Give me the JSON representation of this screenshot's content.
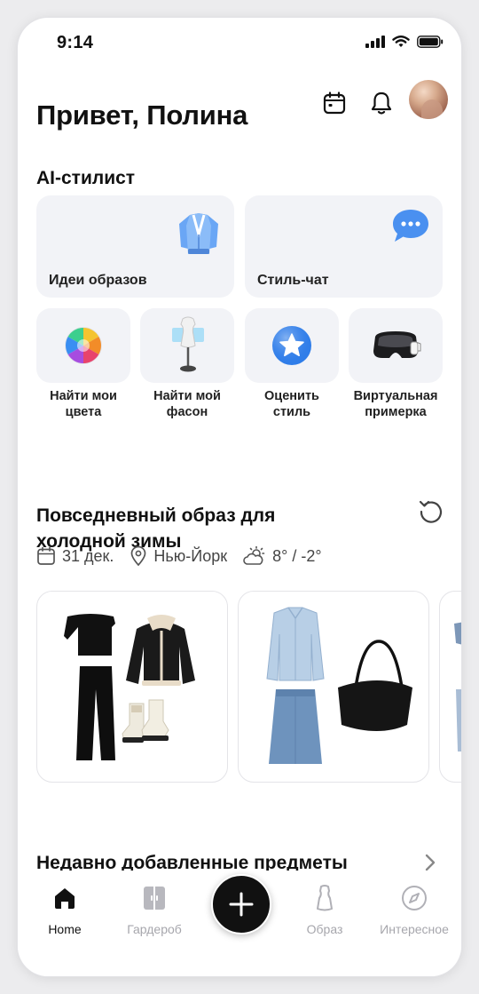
{
  "status_bar": {
    "time": "9:14"
  },
  "header": {
    "greeting": "Привет, Полина"
  },
  "ai_stylist": {
    "title": "AI-стилист",
    "big_cards": [
      {
        "label": "Идеи образов",
        "icon": "cardigan-icon"
      },
      {
        "label": "Стиль-чат",
        "icon": "chat-bubble-icon"
      }
    ],
    "small_cards": [
      {
        "line1": "Найти мои",
        "line2": "цвета",
        "icon": "color-wheel-icon"
      },
      {
        "line1": "Найти мой",
        "line2": "фасон",
        "icon": "mannequin-icon"
      },
      {
        "line1": "Оценить",
        "line2": "стиль",
        "icon": "star-badge-icon"
      },
      {
        "line1": "Виртуальная",
        "line2": "примерка",
        "icon": "vr-headset-icon"
      }
    ]
  },
  "outfit": {
    "title_line1": "Повседневный образ для",
    "title_line2": "холодной зимы",
    "date": "31 дек.",
    "location": "Нью-Йорк",
    "weather": "8° / -2°"
  },
  "recent": {
    "title": "Недавно добавленные предметы"
  },
  "tabbar": {
    "items": [
      {
        "label": "Home",
        "icon": "home-icon",
        "active": true
      },
      {
        "label": "Гардероб",
        "icon": "wardrobe-icon",
        "active": false
      },
      {
        "label": "Образ",
        "icon": "outfit-icon",
        "active": false
      },
      {
        "label": "Интересное",
        "icon": "compass-icon",
        "active": false
      }
    ]
  },
  "colors": {
    "accent": "#111111",
    "card_bg": "#f2f3f7",
    "inactive": "#a6a6ac",
    "chat_blue": "#4a90f0"
  }
}
